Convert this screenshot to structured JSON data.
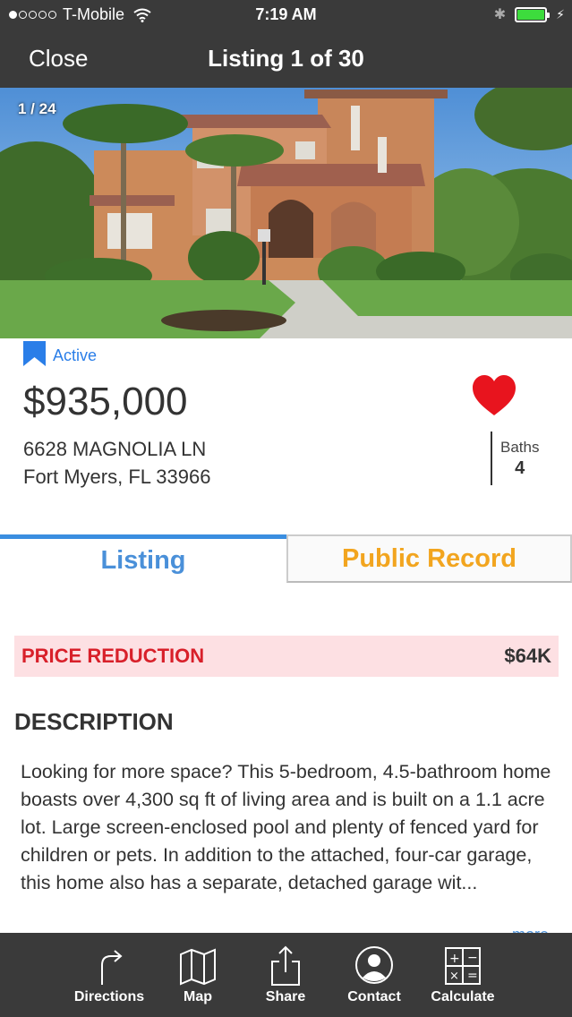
{
  "status_bar": {
    "carrier": "T-Mobile",
    "time": "7:19 AM",
    "signal_dots_filled": 1,
    "signal_dots_total": 5
  },
  "nav": {
    "close_label": "Close",
    "title": "Listing 1 of 30"
  },
  "photo": {
    "counter": "1 / 24"
  },
  "listing": {
    "status": "Active",
    "price": "$935,000",
    "address_line1": "6628 MAGNOLIA LN",
    "address_line2": "Fort Myers, FL 33966",
    "baths_label": "Baths",
    "baths_value": "4"
  },
  "tabs": {
    "listing": "Listing",
    "public_record": "Public Record"
  },
  "price_reduction": {
    "label": "PRICE REDUCTION",
    "value": "$64K"
  },
  "description": {
    "heading": "DESCRIPTION",
    "text": "Looking for more space? This 5-bedroom, 4.5-bathroom home boasts over 4,300 sq ft of living area and is built on a 1.1 acre lot. Large screen-enclosed pool and plenty of fenced yard for children or pets. In addition to the attached, four-car garage, this home also has a separate, detached garage wit...",
    "more_label": "more"
  },
  "toolbar": {
    "directions": "Directions",
    "map": "Map",
    "share": "Share",
    "contact": "Contact",
    "calculate": "Calculate"
  },
  "colors": {
    "bar_background": "#3a3a3a",
    "active_status": "#2a7ee8",
    "listing_tab": "#4a90d9",
    "public_record_tab": "#f2a51f",
    "reduction_label": "#d8202a",
    "reduction_background": "#fde0e3",
    "favorite_heart": "#e8141e"
  },
  "icons": {
    "status_tag": "bookmark-icon",
    "favorite": "heart-icon",
    "directions": "turn-arrow-icon",
    "map": "folded-map-icon",
    "share": "share-icon",
    "contact": "person-icon",
    "calculate": "calculator-icon"
  }
}
